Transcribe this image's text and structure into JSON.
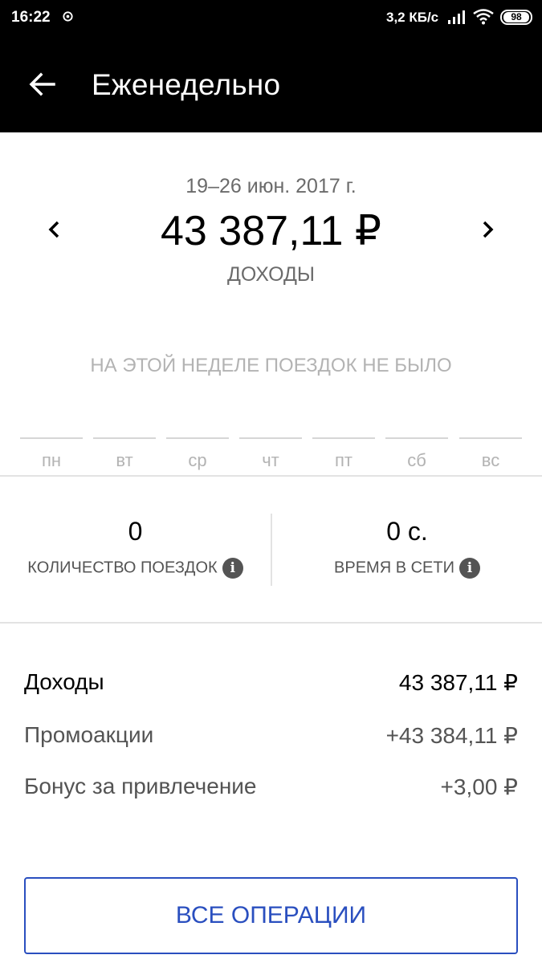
{
  "status_bar": {
    "time": "16:22",
    "network_speed": "3,2 КБ/с",
    "battery": "98",
    "icons": [
      "sync-icon",
      "signal-icon",
      "wifi-icon",
      "battery-icon"
    ]
  },
  "app_bar": {
    "title": "Еженедельно",
    "back_icon": "arrow-left-icon"
  },
  "summary": {
    "period": "19–26 июн. 2017 г.",
    "amount": "43 387,11 ₽",
    "amount_label": "ДОХОДЫ",
    "prev_icon": "chevron-left-icon",
    "next_icon": "chevron-right-icon"
  },
  "empty_message": "НА ЭТОЙ НЕДЕЛЕ ПОЕЗДОК НЕ БЫЛО",
  "days": [
    "пн",
    "вт",
    "ср",
    "чт",
    "пт",
    "сб",
    "вс"
  ],
  "stats": {
    "trips": {
      "value": "0",
      "label": "КОЛИЧЕСТВО ПОЕЗДОК",
      "icon": "info-icon"
    },
    "online": {
      "value": "0 с.",
      "label": "ВРЕМЯ В СЕТИ",
      "icon": "info-icon"
    }
  },
  "breakdown": [
    {
      "label": "Доходы",
      "value": "43 387,11 ₽"
    },
    {
      "label": "Промоакции",
      "value": "+43 384,11 ₽"
    },
    {
      "label": "Бонус за привлечение",
      "value": "+3,00 ₽"
    }
  ],
  "all_operations_label": "ВСЕ ОПЕРАЦИИ",
  "colors": {
    "bar": "#000000",
    "accent": "#2a4fbf",
    "muted": "#6b6b6b",
    "faint": "#b3b3b3"
  }
}
